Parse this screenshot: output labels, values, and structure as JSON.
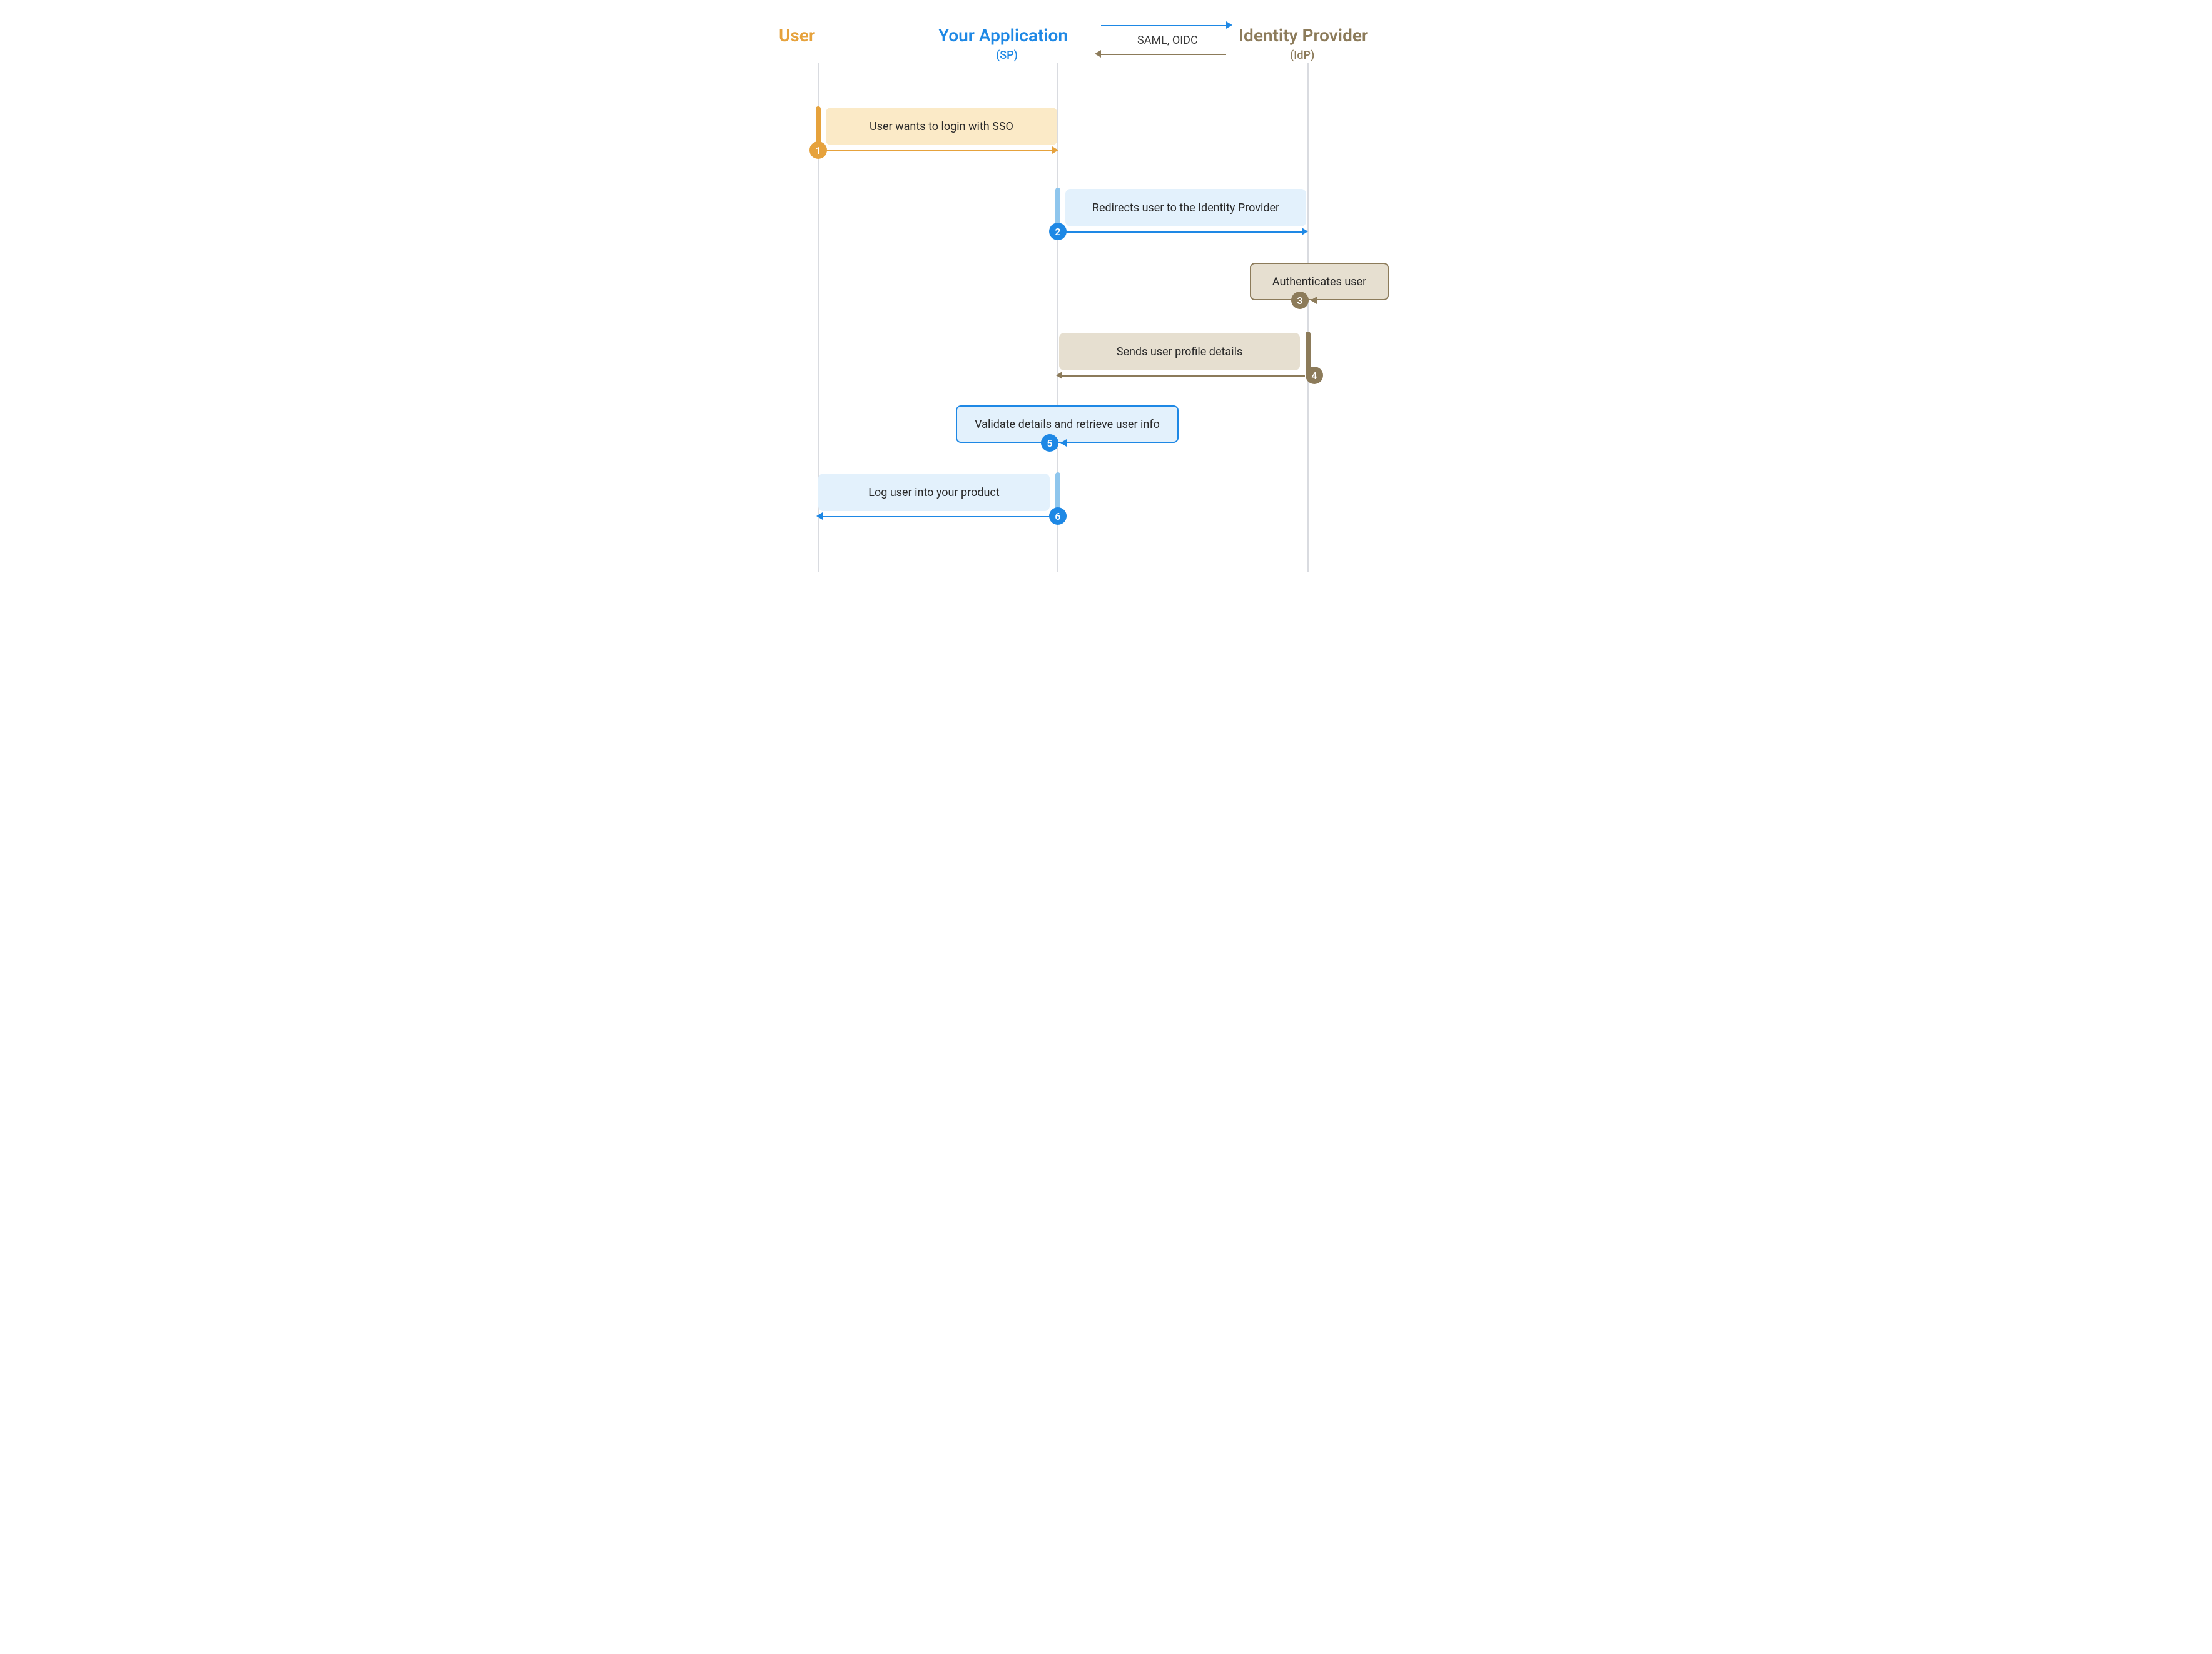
{
  "lanes": {
    "user": {
      "title": "User",
      "sub": ""
    },
    "app": {
      "title": "Your Application",
      "sub": "(SP)"
    },
    "idp": {
      "title": "Identity Provider",
      "sub": "(IdP)"
    }
  },
  "protocol_label": "SAML, OIDC",
  "steps": {
    "s1": {
      "num": "1",
      "label": "User wants to login with SSO"
    },
    "s2": {
      "num": "2",
      "label": "Redirects user to the Identity Provider"
    },
    "s3": {
      "num": "3",
      "label": "Authenticates user"
    },
    "s4": {
      "num": "4",
      "label": "Sends user profile details"
    },
    "s5": {
      "num": "5",
      "label": "Validate details and retrieve user info"
    },
    "s6": {
      "num": "6",
      "label": "Log user into your product"
    }
  },
  "colors": {
    "user": "#E6A23C",
    "app": "#1E88E5",
    "idp": "#8C7B5A",
    "grid": "#D9DBE0"
  }
}
